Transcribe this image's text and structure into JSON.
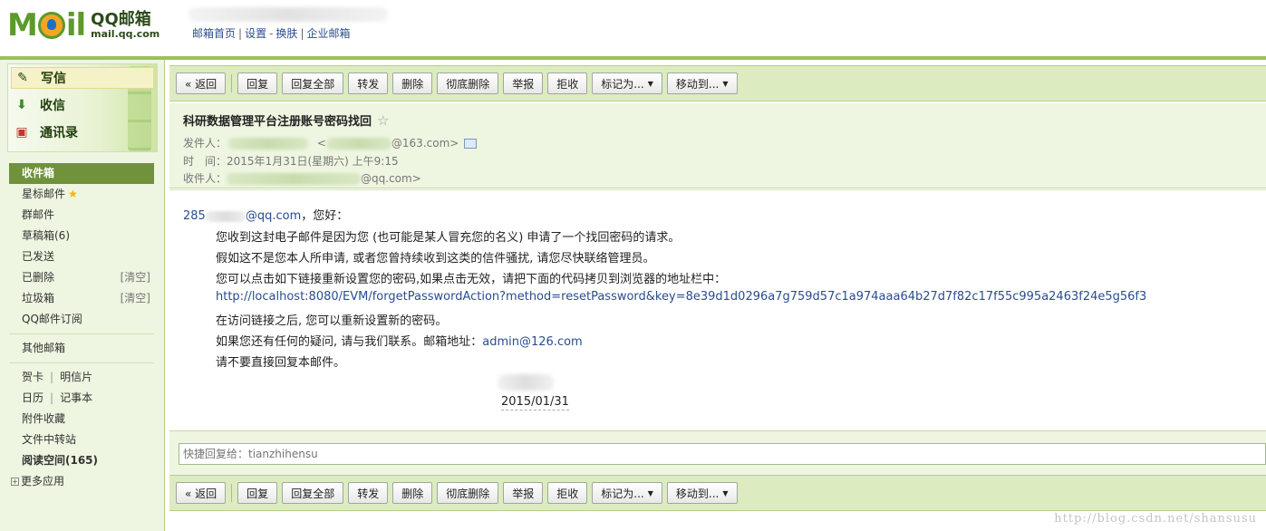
{
  "header": {
    "logo_mark": "MOil",
    "logo_title": "QQ邮箱",
    "logo_url": "mail.qq.com",
    "nav": {
      "home": "邮箱首页",
      "settings": "设置",
      "skin": "换肤",
      "enterprise": "企业邮箱",
      "dash": "-",
      "bar": "|"
    }
  },
  "sidebar": {
    "write": "写信",
    "inbox": "收信",
    "contacts": "通讯录",
    "folders": {
      "inbox": "收件箱",
      "starred": "星标邮件",
      "group": "群邮件",
      "drafts": "草稿箱(6)",
      "sent": "已发送",
      "deleted": "已删除",
      "spam": "垃圾箱",
      "subscription": "QQ邮件订阅",
      "other": "其他邮箱",
      "cards": "贺卡",
      "postcards": "明信片",
      "calendar": "日历",
      "notes": "记事本",
      "attachments": "附件收藏",
      "transfer": "文件中转站",
      "reading": "阅读空间(165)",
      "more_apps": "更多应用",
      "clear_label": "[清空]",
      "pipe": "|"
    }
  },
  "toolbar": {
    "back": "« 返回",
    "reply": "回复",
    "reply_all": "回复全部",
    "forward": "转发",
    "delete": "删除",
    "delete_forever": "彻底删除",
    "report": "举报",
    "reject": "拒收",
    "mark_as": "标记为...",
    "move_to": "移动到...",
    "caret": "▼"
  },
  "mail": {
    "subject": "科研数据管理平台注册账号密码找回",
    "from_label": "发件人：",
    "from_lt": "<",
    "from_domain": "@163.com>",
    "time_label": "时　间：",
    "time_value": "2015年1月31日(星期六) 上午9:15",
    "to_label": "收件人：",
    "to_domain": "@qq.com>",
    "greeting_prefix": "285",
    "greeting_link_suffix": "@qq.com",
    "greeting_rest": "，您好：",
    "line1": "您收到这封电子邮件是因为您 (也可能是某人冒充您的名义) 申请了一个找回密码的请求。",
    "line2": "假如这不是您本人所申请, 或者您曾持续收到这类的信件骚扰, 请您尽快联络管理员。",
    "line3": "您可以点击如下链接重新设置您的密码,如果点击无效，请把下面的代码拷贝到浏览器的地址栏中：",
    "reset_link": "http://localhost:8080/EVM/forgetPasswordAction?method=resetPassword&key=8e39d1d0296a7g759d57c1a974aaa64b27d7f82c17f55c995a2463f24e5g56f3",
    "line5": "在访问链接之后, 您可以重新设置新的密码。",
    "line6_prefix": "如果您还有任何的疑问, 请与我们联系。邮箱地址：",
    "contact_email": "admin@126.com",
    "line7": "请不要直接回复本邮件。",
    "signature_date": "2015/01/31",
    "star_glyph": "☆"
  },
  "quick_reply": {
    "placeholder": "快捷回复给：tianzhihensu"
  },
  "watermark": "http://blog.csdn.net/shansusu",
  "colors": {
    "brand_green": "#5b9a2b",
    "toolbar_bg": "#ddecc0",
    "active_folder": "#6f923a",
    "link": "#2a4d8f"
  }
}
